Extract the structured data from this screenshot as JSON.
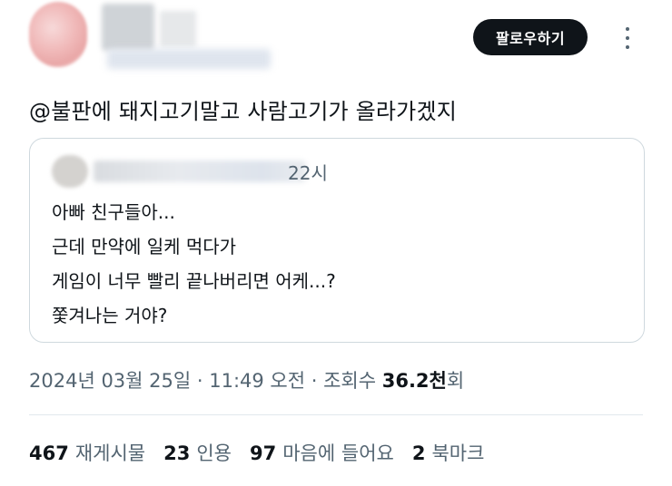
{
  "header": {
    "follow_label": "팔로우하기"
  },
  "tweet": {
    "text": "@불판에 돼지고기말고 사람고기가 올라가겠지"
  },
  "quote": {
    "time": "22시",
    "lines": [
      "아빠 친구들아...",
      "근데 만약에 일케 먹다가",
      "게임이 너무 빨리 끝나버리면 어케...?",
      "쫓겨나는 거야?"
    ]
  },
  "meta": {
    "datetime": "2024년 03월 25일 · 11:49 오전 · 조회수 ",
    "views_number": "36.2",
    "views_unit_bold": "천",
    "views_unit": "회"
  },
  "stats": [
    {
      "count": "467",
      "label": "재게시물"
    },
    {
      "count": "23",
      "label": "인용"
    },
    {
      "count": "97",
      "label": "마음에 들어요"
    },
    {
      "count": "2",
      "label": "북마크"
    }
  ],
  "colors": {
    "text_primary": "#0f1419",
    "text_secondary": "#536471",
    "border": "#cfd9de",
    "button_bg": "#0f1419"
  },
  "icons": {
    "more": "more-vertical-icon"
  }
}
